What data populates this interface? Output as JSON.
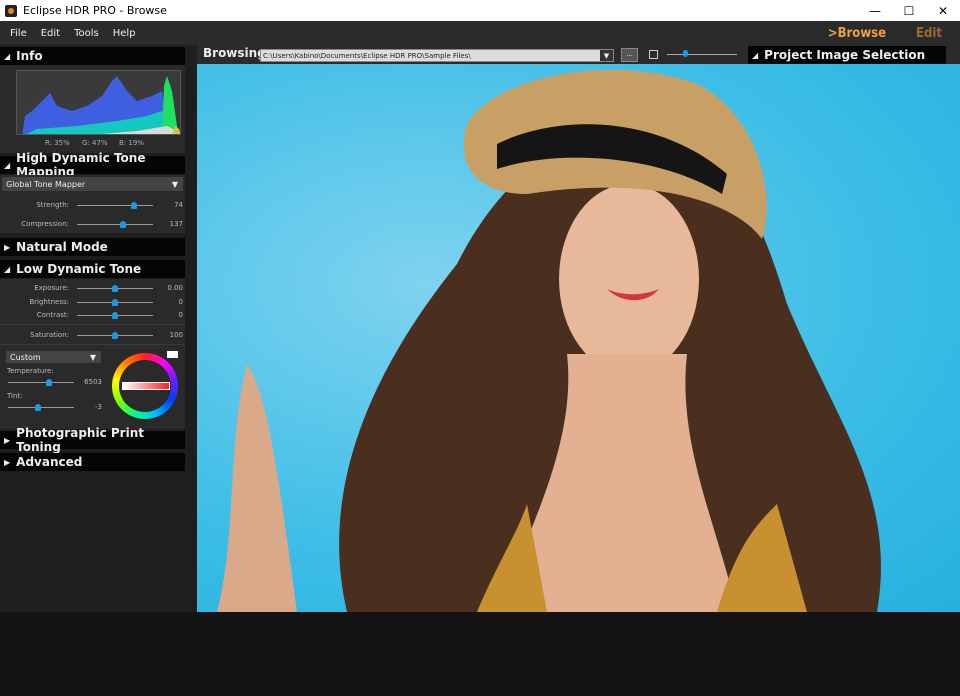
{
  "window": {
    "title": "Eclipse HDR PRO - Browse",
    "minimize": "—",
    "maximize": "☐",
    "close": "✕"
  },
  "menu": [
    "File",
    "Edit",
    "Tools",
    "Help"
  ],
  "modes": {
    "browse": ">Browse",
    "edit": "Edit",
    "active_color": "#f0a040",
    "inactive_color": "#9a6a30"
  },
  "info": {
    "title": "Info",
    "r": "R: 35%",
    "g": "G: 47%",
    "b": "B: 19%"
  },
  "hdtm": {
    "title": "High Dynamic Tone Mapping",
    "mapper": "Global Tone Mapper",
    "sliders": [
      {
        "label": "Strength:",
        "value": "74",
        "level": 0.75
      },
      {
        "label": "Compression:",
        "value": "137",
        "level": 0.6
      }
    ]
  },
  "natural": {
    "title": "Natural Mode"
  },
  "ldt": {
    "title": "Low Dynamic Tone",
    "sliders": [
      {
        "label": "Exposure:",
        "value": "0.00",
        "level": 0.5
      },
      {
        "label": "Brightness:",
        "value": "0",
        "level": 0.5
      },
      {
        "label": "Contrast:",
        "value": "0",
        "level": 0.5
      },
      {
        "label": "Saturation:",
        "value": "100",
        "level": 0.5
      }
    ],
    "preset": "Custom",
    "temperature_label": "Temperature:",
    "temperature": "6503",
    "temperature_level": 0.62,
    "tint_label": "Tint:",
    "tint": "-3",
    "tint_level": 0.45
  },
  "print": {
    "title": "Photographic Print Toning"
  },
  "advanced": {
    "title": "Advanced"
  },
  "browse": {
    "label": "Browsing:",
    "path": "C:\\Users\\Kabino\\Documents\\Eclipse HDR PRO\\Sample Files\\",
    "more": "...",
    "zoom_level": 0.25
  },
  "project": {
    "title": "Project Image Selection"
  }
}
